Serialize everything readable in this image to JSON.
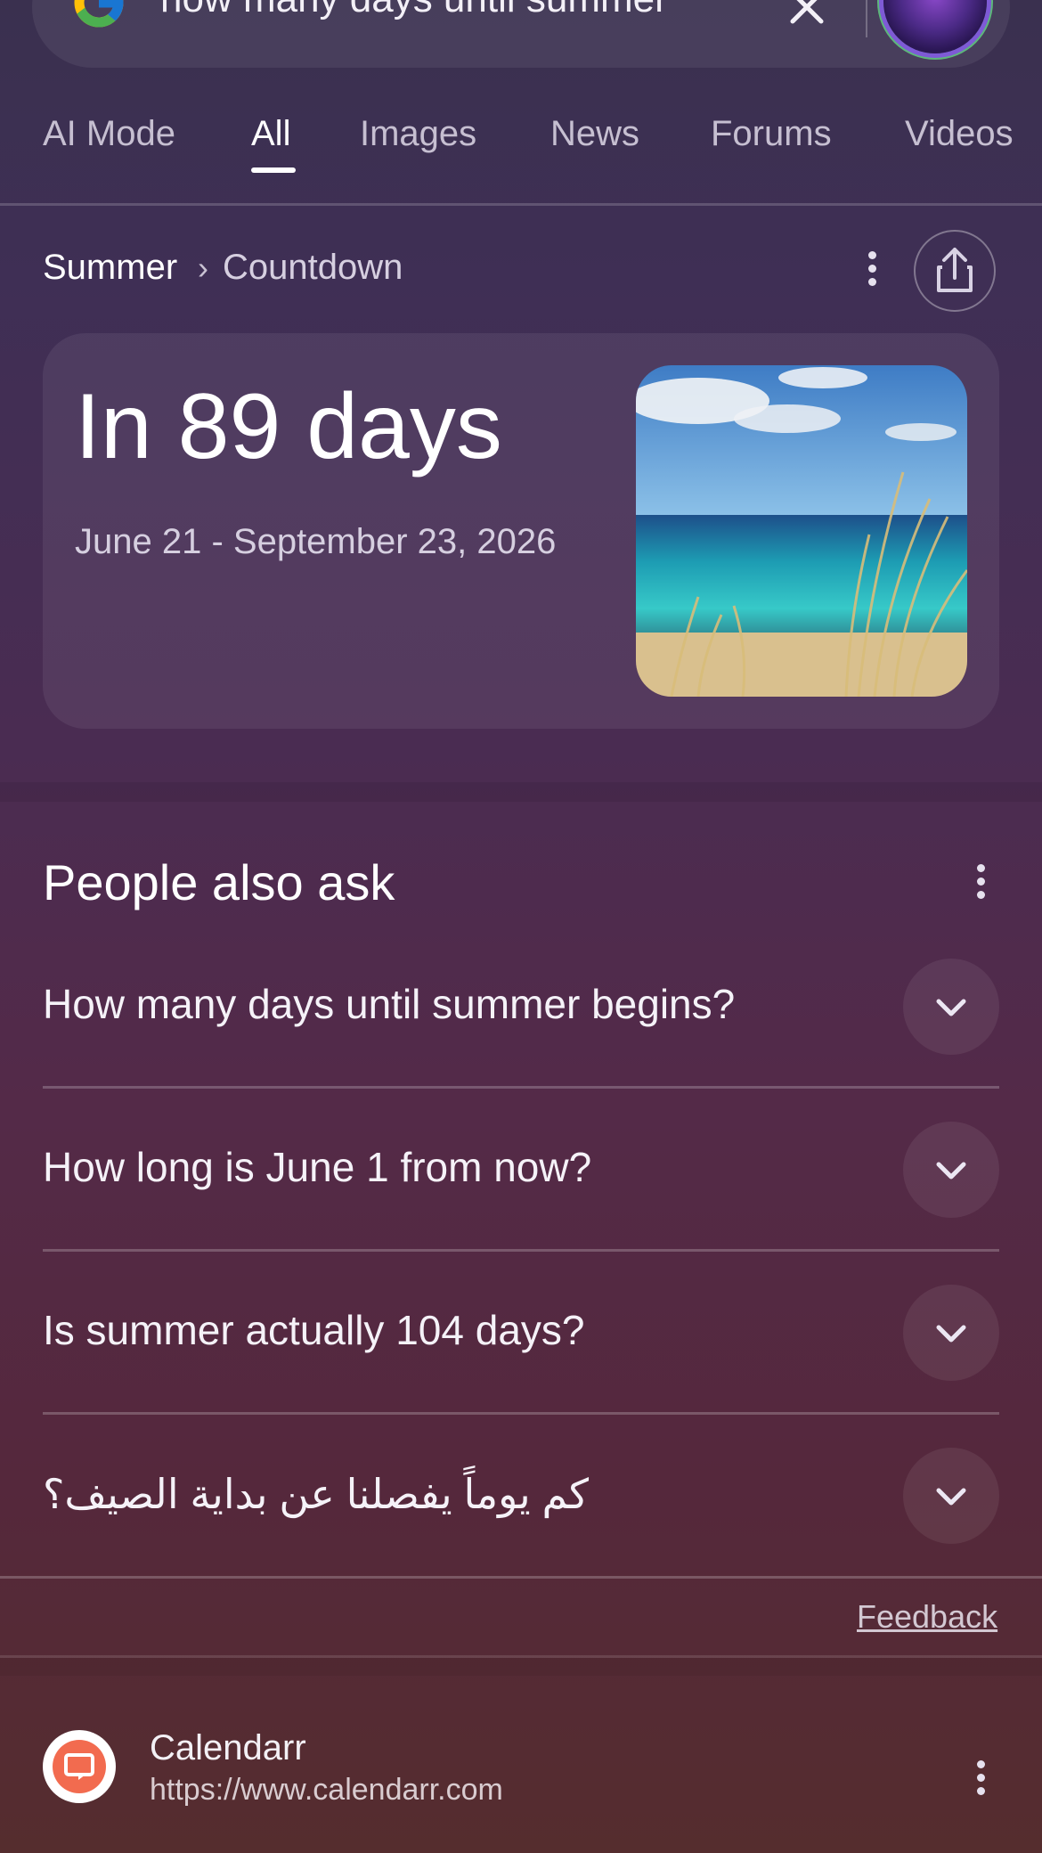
{
  "search": {
    "query": "how many days until summer",
    "clear_icon": "close-icon",
    "logo": "google-g-logo",
    "avatar": "user-avatar"
  },
  "tabs": [
    {
      "label": "AI Mode",
      "active": false
    },
    {
      "label": "All",
      "active": true
    },
    {
      "label": "Images",
      "active": false
    },
    {
      "label": "News",
      "active": false
    },
    {
      "label": "Forums",
      "active": false
    },
    {
      "label": "Videos",
      "active": false
    }
  ],
  "breadcrumb": {
    "parent": "Summer",
    "separator": "›",
    "current": "Countdown"
  },
  "countdown": {
    "headline": "In 89 days",
    "date_range": "June 21 - September 23, 2026",
    "image": "beach-dune-grass-image"
  },
  "people_also_ask": {
    "title": "People also ask",
    "questions": [
      "How many days until summer begins?",
      "How long is June 1 from now?",
      "Is summer actually 104 days?",
      "كم يوماً يفصلنا عن بداية الصيف؟"
    ]
  },
  "feedback": {
    "label": "Feedback"
  },
  "result": {
    "site_name": "Calendarr",
    "url": "https://www.calendarr.com",
    "favicon_color": "#f26b4f"
  },
  "colors": {
    "accent_white": "#ffffff",
    "secondary_text": "#d6cfe0"
  }
}
